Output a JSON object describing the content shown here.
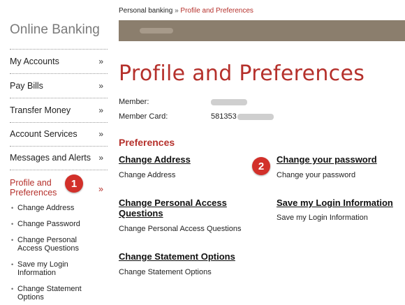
{
  "sidebar": {
    "title": "Online Banking",
    "items": [
      {
        "label": "My Accounts",
        "chevron": "»"
      },
      {
        "label": "Pay Bills",
        "chevron": "»"
      },
      {
        "label": "Transfer Money",
        "chevron": "»"
      },
      {
        "label": "Account Services",
        "chevron": "»"
      },
      {
        "label": "Messages and Alerts",
        "chevron": "»"
      }
    ],
    "active": {
      "label_line1": "Profile and",
      "label_line2": "Preferences",
      "chevron": "»"
    },
    "subitems": [
      {
        "line1": "Change Address",
        "line2": ""
      },
      {
        "line1": "Change Password",
        "line2": ""
      },
      {
        "line1": "Change Personal",
        "line2": "Access Questions"
      },
      {
        "line1": "Save my Login",
        "line2": "Information"
      },
      {
        "line1": "Change Statement",
        "line2": "Options"
      }
    ],
    "bullet": "•"
  },
  "badges": {
    "one": "1",
    "two": "2"
  },
  "breadcrumb": {
    "root": "Personal banking",
    "sep": "»",
    "current": "Profile and Preferences"
  },
  "page_title": "Profile and Preferences",
  "member": {
    "label": "Member:",
    "card_label": "Member Card:",
    "card_prefix": "581353"
  },
  "preferences": {
    "heading": "Preferences",
    "change_address": {
      "title": "Change Address",
      "desc": "Change Address"
    },
    "change_password": {
      "title": "Change your password",
      "desc": "Change your password"
    },
    "change_questions": {
      "title_line1": "Change Personal Access",
      "title_line2": "Questions",
      "desc": "Change Personal Access Questions"
    },
    "save_login": {
      "title": "Save my Login Information",
      "desc": "Save my Login Information"
    },
    "change_statement": {
      "title": "Change Statement Options",
      "desc": "Change Statement Options"
    }
  },
  "colors": {
    "accent": "#b5302b",
    "banner": "#8b7e6d",
    "badge": "#d2302a"
  }
}
